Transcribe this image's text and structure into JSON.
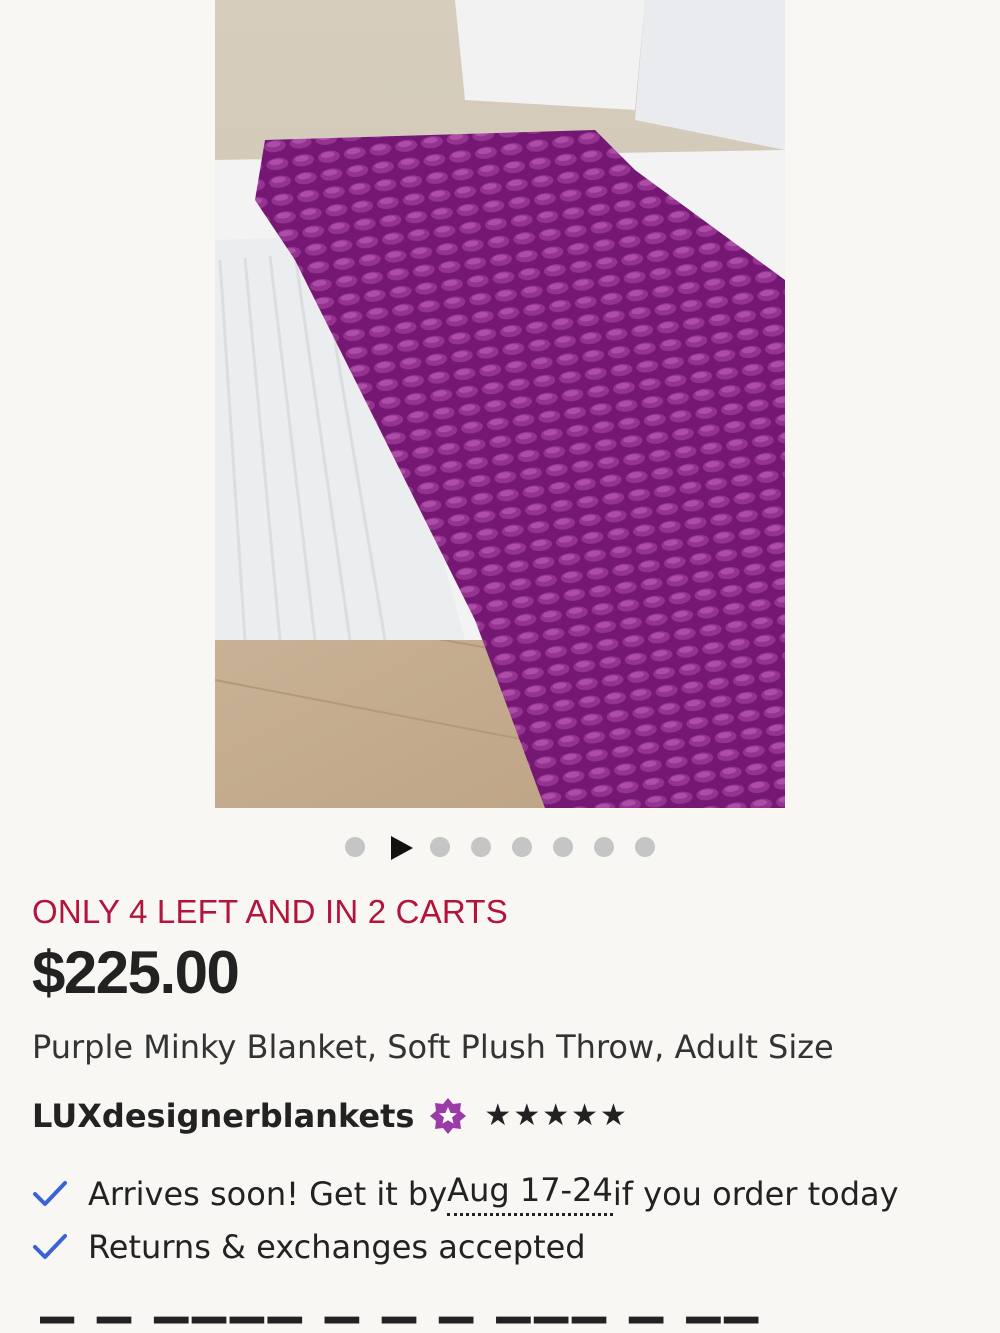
{
  "media": {
    "image_label": "Purple minky blanket on bed",
    "carousel": {
      "slide_count": 8,
      "active_index": 1,
      "active_is_video": true
    }
  },
  "listing": {
    "scarcity": "ONLY 4 LEFT AND IN 2 CARTS",
    "price": "$225.00",
    "title": "Purple Minky Blanket, Soft Plush Throw, Adult Size",
    "shop": {
      "name": "LUXdesignerblankets",
      "badge_icon": "star-seller-badge-icon",
      "rating": 5,
      "rating_max": 5
    }
  },
  "perks": [
    {
      "icon": "check-icon",
      "prefix": "Arrives soon! Get it by ",
      "dates": "Aug 17-24",
      "suffix": " if you order today"
    },
    {
      "icon": "check-icon",
      "text": "Returns & exchanges accepted"
    }
  ],
  "colors": {
    "scarcity": "#b3143c",
    "check": "#3b63d8",
    "badge": "#9b3ba8",
    "background": "#f8f7f4"
  }
}
